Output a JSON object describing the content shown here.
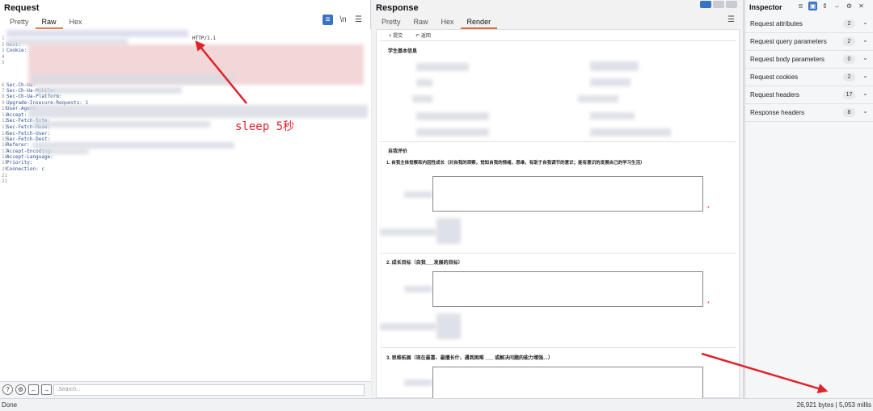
{
  "request": {
    "title": "Request",
    "tabs": [
      "Pretty",
      "Raw",
      "Hex"
    ],
    "active_tab": "Raw",
    "lines": [
      {
        "n": "1",
        "text": "",
        "tail": "HTTP/1.1"
      },
      {
        "n": "2",
        "text": "Host:"
      },
      {
        "n": "3",
        "text": "Cookie:"
      },
      {
        "n": "4",
        "text": ""
      },
      {
        "n": "5",
        "text": ""
      },
      {
        "n": "6",
        "text": "Sec-Ch-Ua:"
      },
      {
        "n": "7",
        "text": "Sec-Ch-Ua-Mobile:"
      },
      {
        "n": "8",
        "text": "Sec-Ch-Ua-Platform:"
      },
      {
        "n": "9",
        "text": "Upgrade-Insecure-Requests: 1"
      },
      {
        "n": "10",
        "text": "User-Agent:"
      },
      {
        "n": "11",
        "text": "Accept:"
      },
      {
        "n": "12",
        "text": "Sec-Fetch-Site:"
      },
      {
        "n": "13",
        "text": "Sec-Fetch-Mode:"
      },
      {
        "n": "14",
        "text": "Sec-Fetch-User:"
      },
      {
        "n": "15",
        "text": "Sec-Fetch-Dest:"
      },
      {
        "n": "16",
        "text": "Referer:"
      },
      {
        "n": "17",
        "text": "Accept-Encoding:"
      },
      {
        "n": "18",
        "text": "Accept-Language:"
      },
      {
        "n": "19",
        "text": "Priority:"
      },
      {
        "n": "20",
        "text": "Connection: c"
      },
      {
        "n": "21",
        "text": ""
      },
      {
        "n": "22",
        "text": ""
      }
    ],
    "annotation": "sleep 5秒",
    "search_placeholder": "Search..."
  },
  "response": {
    "title": "Response",
    "tabs": [
      "Pretty",
      "Raw",
      "Hex",
      "Render"
    ],
    "active_tab": "Render",
    "toolbar": {
      "submit": "+ 提交",
      "back": "↶ 返回"
    },
    "section_basic": "学生基本信息",
    "section_eval": "自我评价",
    "q1": "1. 自我主体觉察和内因性成长（对自我的观察，觉知自我的情绪，思维，有助于自我调节的意识；能有意识的发展自己的学习生活）",
    "q2": "2. 成长目标（自我___发展的目标）",
    "q3": "3. 思维拓展（现在最喜、最擅长什、遇到困难  ___ 或解决问题的能力增强…）"
  },
  "inspector": {
    "title": "Inspector",
    "rows": [
      {
        "label": "Request attributes",
        "count": "2"
      },
      {
        "label": "Request query parameters",
        "count": "2"
      },
      {
        "label": "Request body parameters",
        "count": "0"
      },
      {
        "label": "Request cookies",
        "count": "2"
      },
      {
        "label": "Request headers",
        "count": "17"
      },
      {
        "label": "Response headers",
        "count": "8"
      }
    ]
  },
  "status": {
    "left": "Done",
    "right": "26,921 bytes | 5,053 millis"
  },
  "colors": {
    "accent": "#e06b2a",
    "annotation": "#e0222b",
    "selected": "#3b73c4"
  }
}
